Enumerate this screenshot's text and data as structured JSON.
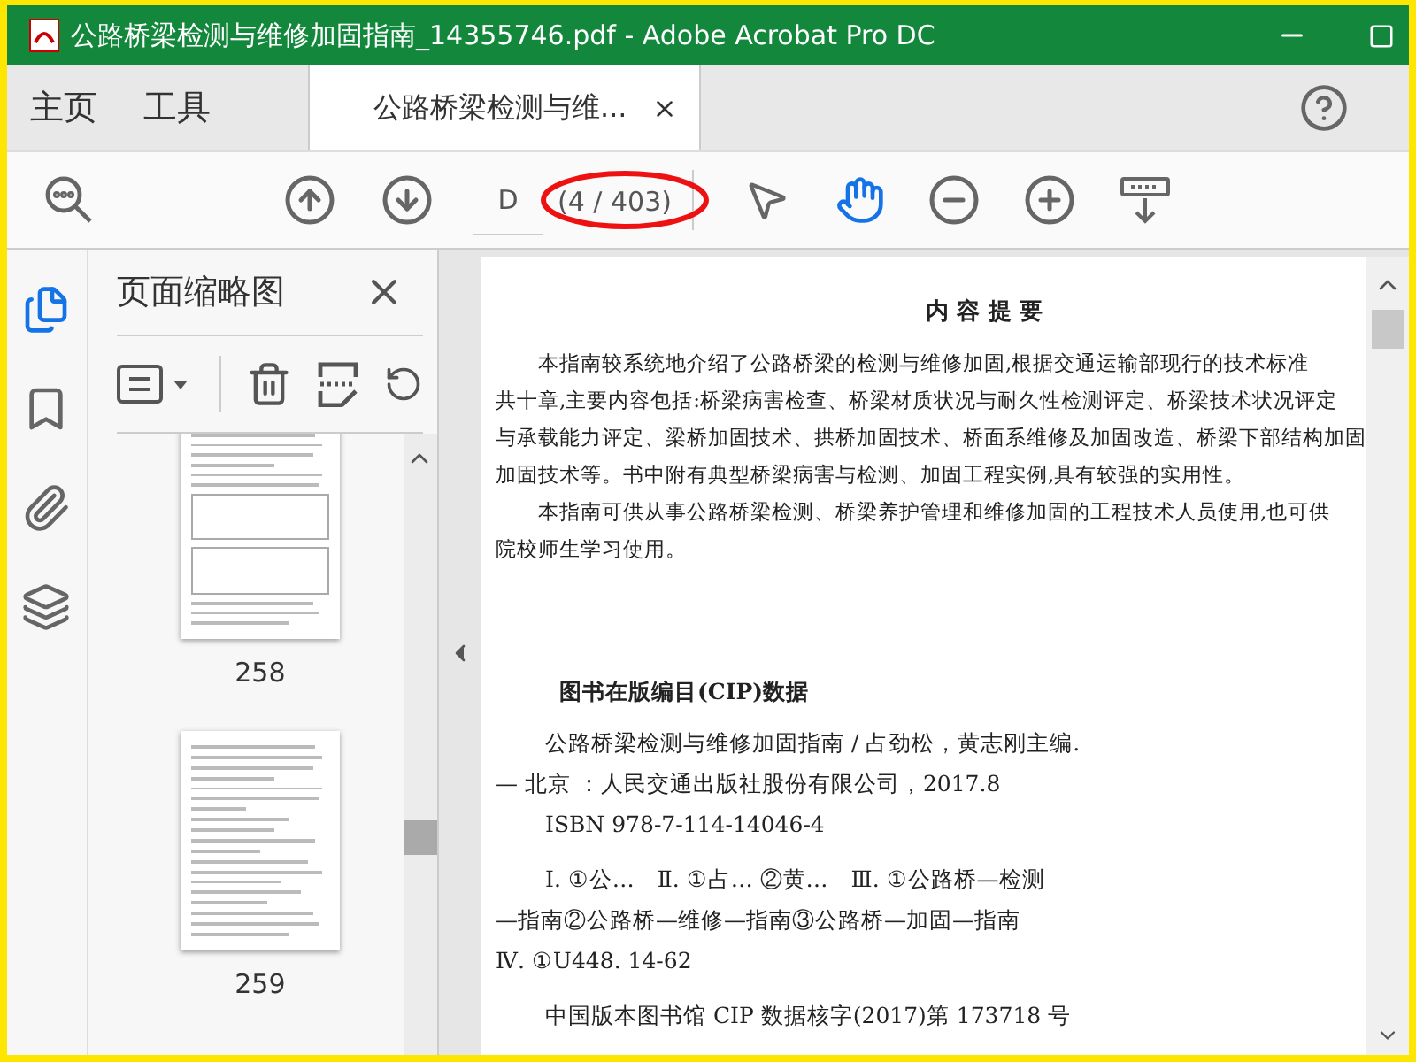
{
  "window": {
    "title": "公路桥梁检测与维修加固指南_14355746.pdf - Adobe Acrobat Pro DC"
  },
  "tabs": [
    {
      "label": "主页",
      "selected": false
    },
    {
      "label": "工具",
      "selected": false
    },
    {
      "label": "公路桥梁检测与维...",
      "selected": true
    }
  ],
  "toolbar": {
    "page_input": "D",
    "page_count": "(4 / 403)",
    "pointer_tools": [
      {
        "kind": "arrow",
        "selected": false
      },
      {
        "kind": "hand",
        "selected": true
      }
    ]
  },
  "rail": [
    {
      "kind": "pages",
      "selected": true
    },
    {
      "kind": "bookmarks",
      "selected": false
    },
    {
      "kind": "attachments",
      "selected": false
    },
    {
      "kind": "layers",
      "selected": false
    }
  ],
  "thumbnails_panel": {
    "title": "页面缩略图",
    "pages": [
      {
        "label": "258",
        "kind": "figure"
      },
      {
        "label": "259",
        "kind": "formula"
      }
    ]
  },
  "document": {
    "heading": "内 容 提 要",
    "paragraph_lines": [
      {
        "text": "本指南较系统地介绍了公路桥梁的检测与维修加固,根据交通运输部现行的技术标准",
        "indented": true
      },
      {
        "text": "共十章,主要内容包括:桥梁病害检查、桥梁材质状况与耐久性检测评定、桥梁技术状况评定",
        "indented": false
      },
      {
        "text": "与承载能力评定、梁桥加固技术、拱桥加固技术、桥面系维修及加固改造、桥梁下部结构加固",
        "indented": false
      },
      {
        "text": "加固技术等。书中附有典型桥梁病害与检测、加固工程实例,具有较强的实用性。",
        "indented": false
      },
      {
        "text": "本指南可供从事公路桥梁检测、桥梁养护管理和维修加固的工程技术人员使用,也可供",
        "indented": true
      },
      {
        "text": "院校师生学习使用。",
        "indented": false
      }
    ],
    "cip_heading": "图书在版编目(CIP)数据",
    "cip_groups": [
      [
        {
          "text": "公路桥梁检测与维修加固指南 / 占劲松，黄志刚主编.",
          "indented": true
        },
        {
          "text": "— 北京 ：人民交通出版社股份有限公司，2017.8",
          "indented": false
        },
        {
          "text": "ISBN 978-7-114-14046-4",
          "indented": true
        }
      ],
      [
        {
          "text": "Ⅰ. ①公…　Ⅱ. ①占… ②黄…　Ⅲ. ①公路桥—检测",
          "indented": true
        },
        {
          "text": "—指南②公路桥—维修—指南③公路桥—加固—指南",
          "indented": false
        },
        {
          "text": "Ⅳ. ①U448. 14-62",
          "indented": false
        }
      ],
      [
        {
          "text": "中国版本图书馆 CIP 数据核字(2017)第 173718 号",
          "indented": true
        }
      ]
    ]
  }
}
